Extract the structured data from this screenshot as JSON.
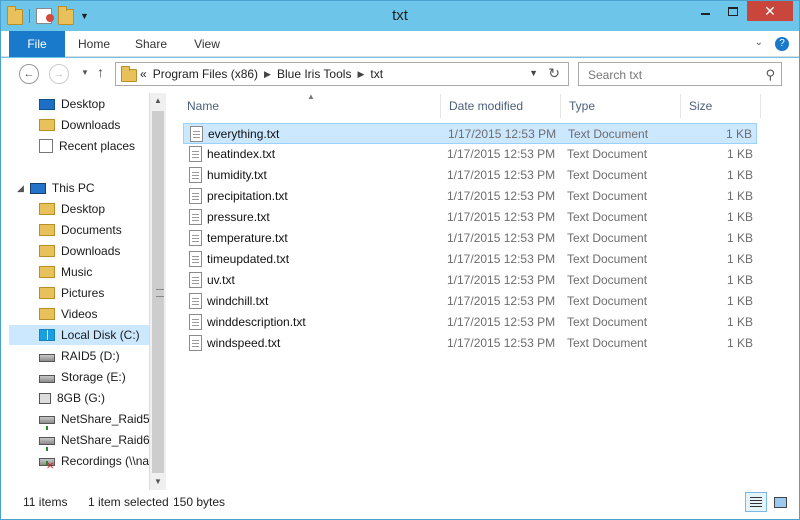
{
  "window": {
    "title": "txt",
    "controls": {
      "minimize": "",
      "maximize": "",
      "close": "✕"
    }
  },
  "ribbon": {
    "tabs": [
      "File",
      "Home",
      "Share",
      "View"
    ],
    "expand_icon": "chevron-down-icon",
    "help_icon": "help-icon"
  },
  "nav": {
    "breadcrumbs": [
      "Program Files (x86)",
      "Blue Iris Tools",
      "txt"
    ],
    "overflow": "«",
    "search_placeholder": "Search txt"
  },
  "sidebar": {
    "favorites": [
      {
        "label": "Desktop",
        "icon": "desktop-icon"
      },
      {
        "label": "Downloads",
        "icon": "downloads-folder-icon"
      },
      {
        "label": "Recent places",
        "icon": "recent-places-icon"
      }
    ],
    "this_pc": {
      "label": "This PC",
      "icon": "computer-icon"
    },
    "pc_items": [
      {
        "label": "Desktop",
        "icon": "folder-icon"
      },
      {
        "label": "Documents",
        "icon": "folder-icon"
      },
      {
        "label": "Downloads",
        "icon": "folder-icon"
      },
      {
        "label": "Music",
        "icon": "folder-icon"
      },
      {
        "label": "Pictures",
        "icon": "folder-icon"
      },
      {
        "label": "Videos",
        "icon": "folder-icon"
      },
      {
        "label": "Local Disk (C:)",
        "icon": "windows-drive-icon",
        "selected": true
      },
      {
        "label": "RAID5 (D:)",
        "icon": "drive-icon"
      },
      {
        "label": "Storage (E:)",
        "icon": "drive-icon"
      },
      {
        "label": "8GB (G:)",
        "icon": "usb-drive-icon"
      },
      {
        "label": "NetShare_Raid5 (",
        "icon": "network-drive-icon"
      },
      {
        "label": "NetShare_Raid6 (",
        "icon": "network-drive-icon"
      },
      {
        "label": "Recordings (\\\\na",
        "icon": "disconnected-network-drive-icon"
      }
    ]
  },
  "file_list": {
    "columns": [
      "Name",
      "Date modified",
      "Type",
      "Size"
    ],
    "rows": [
      {
        "name": "everything.txt",
        "date": "1/17/2015 12:53 PM",
        "type": "Text Document",
        "size": "1 KB",
        "selected": true
      },
      {
        "name": "heatindex.txt",
        "date": "1/17/2015 12:53 PM",
        "type": "Text Document",
        "size": "1 KB"
      },
      {
        "name": "humidity.txt",
        "date": "1/17/2015 12:53 PM",
        "type": "Text Document",
        "size": "1 KB"
      },
      {
        "name": "precipitation.txt",
        "date": "1/17/2015 12:53 PM",
        "type": "Text Document",
        "size": "1 KB"
      },
      {
        "name": "pressure.txt",
        "date": "1/17/2015 12:53 PM",
        "type": "Text Document",
        "size": "1 KB"
      },
      {
        "name": "temperature.txt",
        "date": "1/17/2015 12:53 PM",
        "type": "Text Document",
        "size": "1 KB"
      },
      {
        "name": "timeupdated.txt",
        "date": "1/17/2015 12:53 PM",
        "type": "Text Document",
        "size": "1 KB"
      },
      {
        "name": "uv.txt",
        "date": "1/17/2015 12:53 PM",
        "type": "Text Document",
        "size": "1 KB"
      },
      {
        "name": "windchill.txt",
        "date": "1/17/2015 12:53 PM",
        "type": "Text Document",
        "size": "1 KB"
      },
      {
        "name": "winddescription.txt",
        "date": "1/17/2015 12:53 PM",
        "type": "Text Document",
        "size": "1 KB"
      },
      {
        "name": "windspeed.txt",
        "date": "1/17/2015 12:53 PM",
        "type": "Text Document",
        "size": "1 KB"
      }
    ]
  },
  "status": {
    "item_count": "11 items",
    "selection": "1 item selected",
    "selection_size": "150 bytes"
  },
  "colors": {
    "title_bar": "#6dc5ea",
    "file_tab": "#1979ca",
    "selection": "#cce8ff",
    "selection_border": "#99d1ff",
    "close_button": "#c9463d"
  }
}
